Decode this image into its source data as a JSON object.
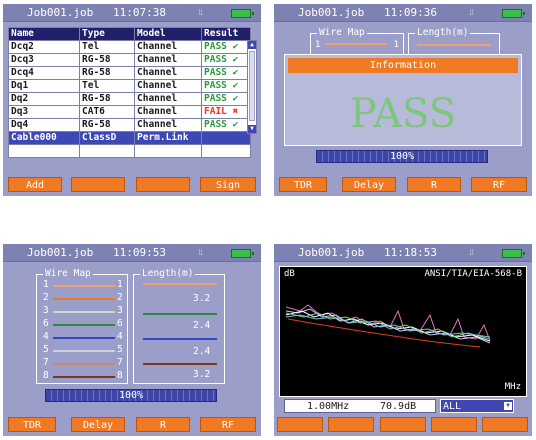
{
  "screen1": {
    "title": "Job001.job",
    "time": "11:07:38",
    "columns": [
      "Name",
      "Type",
      "Model",
      "Result"
    ],
    "rows": [
      {
        "name": "Dcq2",
        "type": "Tel",
        "model": "Channel",
        "result": "PASS"
      },
      {
        "name": "Dcq3",
        "type": "RG-58",
        "model": "Channel",
        "result": "PASS"
      },
      {
        "name": "Dcq4",
        "type": "RG-58",
        "model": "Channel",
        "result": "PASS"
      },
      {
        "name": "Dq1",
        "type": "Tel",
        "model": "Channel",
        "result": "PASS"
      },
      {
        "name": "Dq2",
        "type": "RG-58",
        "model": "Channel",
        "result": "PASS"
      },
      {
        "name": "Dq3",
        "type": "CAT6",
        "model": "Channel",
        "result": "FAIL"
      },
      {
        "name": "Dq4",
        "type": "RG-58",
        "model": "Channel",
        "result": "PASS"
      },
      {
        "name": "Cable000",
        "type": "ClassD",
        "model": "Perm.Link",
        "result": ""
      }
    ],
    "buttons": [
      "Add",
      "",
      "",
      "Sign"
    ]
  },
  "screen2": {
    "title": "Job001.job",
    "time": "11:09:36",
    "wiremap_label": "Wire Map",
    "wiremap_left": "1",
    "wiremap_right": "1",
    "length_label": "Length(m)",
    "info_header": "Information",
    "result": "PASS",
    "progress": "100%",
    "buttons": [
      "TDR",
      "Delay",
      "R",
      "RF"
    ]
  },
  "screen3": {
    "title": "Job001.job",
    "time": "11:09:53",
    "wiremap_label": "Wire Map",
    "length_label": "Length(m)",
    "pins": [
      {
        "left": "1",
        "right": "1",
        "color": "#f0a06a"
      },
      {
        "left": "2",
        "right": "2",
        "color": "#e87a2a"
      },
      {
        "left": "3",
        "right": "3",
        "color": "#bfe0bf"
      },
      {
        "left": "6",
        "right": "6",
        "color": "#2e8a3a"
      },
      {
        "left": "4",
        "right": "4",
        "color": "#2a48c8"
      },
      {
        "left": "5",
        "right": "5",
        "color": "#c8d0f0"
      },
      {
        "left": "7",
        "right": "7",
        "color": "#c88a6a"
      },
      {
        "left": "8",
        "right": "8",
        "color": "#7a3a1a"
      }
    ],
    "lengths": [
      "3.2",
      "2.4",
      "2.4",
      "3.2"
    ],
    "progress": "100%",
    "buttons": [
      "TDR",
      "Delay",
      "R",
      "RF"
    ]
  },
  "screen4": {
    "title": "Job001.job",
    "time": "11:18:53",
    "y_unit": "dB",
    "standard": "ANSI/TIA/EIA-568-B",
    "x_unit": "MHz",
    "frequency": "1.00MHz",
    "value": "70.9dB",
    "select": "ALL",
    "buttons": [
      "",
      "",
      "",
      "",
      ""
    ]
  },
  "colors": {
    "screen_bg": "#9b9ec9",
    "button": "#f07a24",
    "pass": "#2c9a3a",
    "fail": "#e33b24",
    "selected_row": "#3d48b6"
  }
}
